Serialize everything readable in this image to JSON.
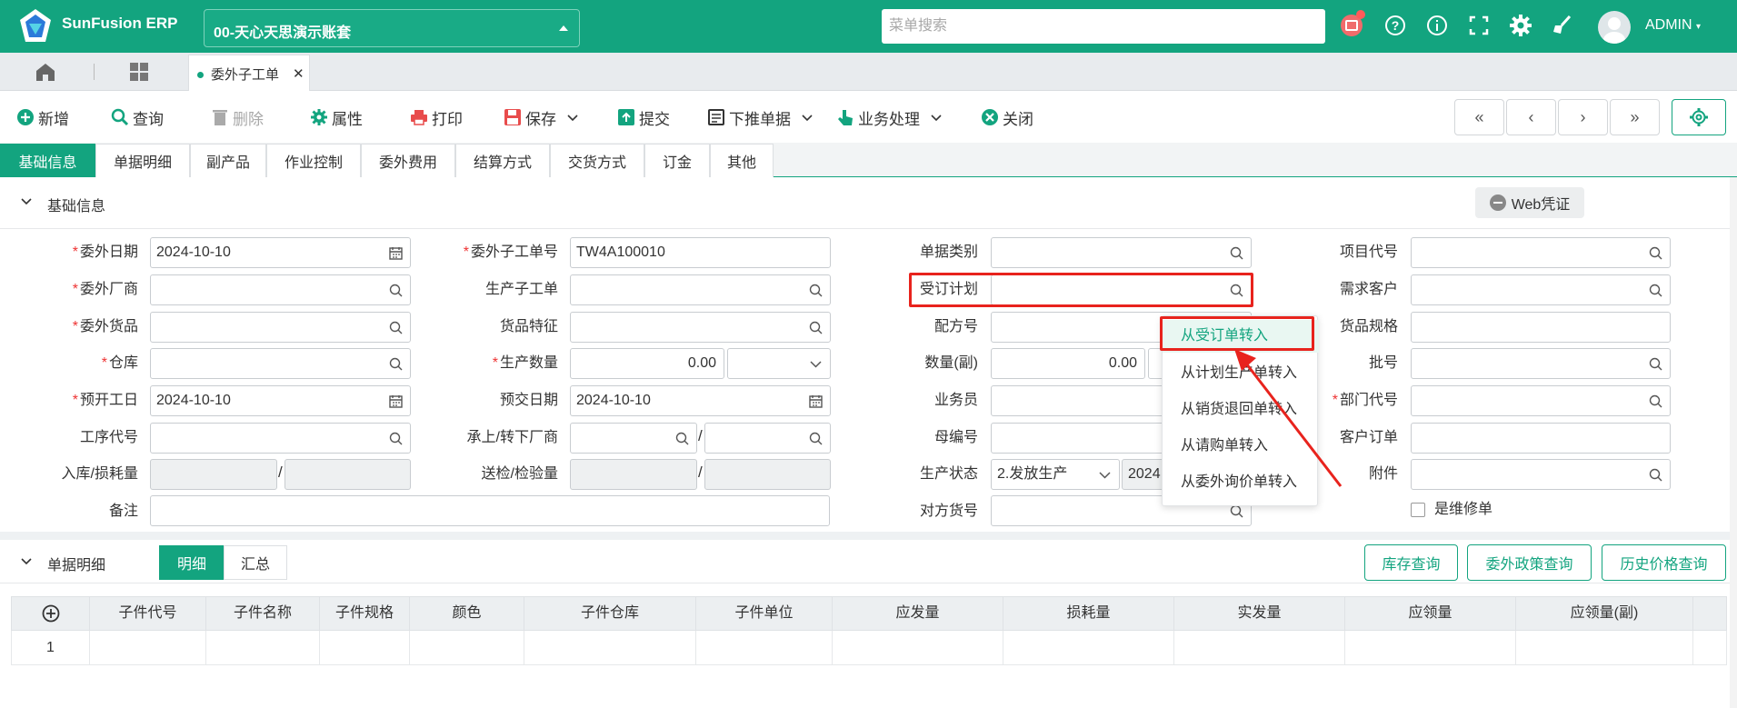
{
  "header": {
    "brand": "SunFusion ERP",
    "account": "00-天心天思演示账套",
    "search_placeholder": "菜单搜索",
    "user": "ADMIN"
  },
  "tabs": {
    "open_tab": "委外子工单"
  },
  "toolbar": {
    "new": "新增",
    "query": "查询",
    "delete": "删除",
    "properties": "属性",
    "print": "打印",
    "save": "保存",
    "submit": "提交",
    "push_down": "下推单据",
    "business": "业务处理",
    "close": "关闭"
  },
  "subtabs": [
    "基础信息",
    "单据明细",
    "副产品",
    "作业控制",
    "委外费用",
    "结算方式",
    "交货方式",
    "订金",
    "其他"
  ],
  "form": {
    "section_title": "基础信息",
    "web_voucher": "Web凭证",
    "labels": {
      "outsource_date": "委外日期",
      "outsource_vendor": "委外厂商",
      "outsource_goods": "委外货品",
      "warehouse": "仓库",
      "planned_start": "预开工日",
      "process_code": "工序代号",
      "in_loss": "入库/损耗量",
      "remark": "备注",
      "sub_order_no": "委外子工单号",
      "prod_sub_order": "生产子工单",
      "goods_feature": "货品特征",
      "prod_qty": "生产数量",
      "planned_delivery": "预交日期",
      "upper_lower_vendor": "承上/转下厂商",
      "inspect_qty": "送检/检验量",
      "doc_type": "单据类别",
      "sales_plan": "受订计划",
      "formula_no": "配方号",
      "qty_aux": "数量(副)",
      "salesman": "业务员",
      "parent_no": "母编号",
      "prod_status": "生产状态",
      "counter_goods": "对方货号",
      "project_code": "项目代号",
      "demand_customer": "需求客户",
      "goods_spec": "货品规格",
      "batch_no": "批号",
      "dept_code": "部门代号",
      "customer_order": "客户订单",
      "attachment": "附件",
      "is_repair": "是维修单"
    },
    "values": {
      "outsource_date": "2024-10-10",
      "sub_order_no": "TW4A100010",
      "planned_start": "2024-10-10",
      "planned_delivery": "2024-10-10",
      "prod_qty": "0.00",
      "qty_aux": "0.00",
      "prod_status": "2.发放生产",
      "prod_status_date": "2024"
    }
  },
  "popup_items": [
    "从受订单转入",
    "从计划生产单转入",
    "从销货退回单转入",
    "从请购单转入",
    "从委外询价单转入"
  ],
  "detail": {
    "title": "单据明细",
    "seg_detail": "明细",
    "seg_summary": "汇总",
    "btn_stock": "库存查询",
    "btn_policy": "委外政策查询",
    "btn_history": "历史价格查询",
    "columns": [
      "子件代号",
      "子件名称",
      "子件规格",
      "颜色",
      "子件仓库",
      "子件单位",
      "应发量",
      "损耗量",
      "实发量",
      "应领量",
      "应领量(副)"
    ],
    "row_no": "1"
  },
  "colors": {
    "primary": "#13a47f",
    "highlight_red": "#e8231d"
  }
}
